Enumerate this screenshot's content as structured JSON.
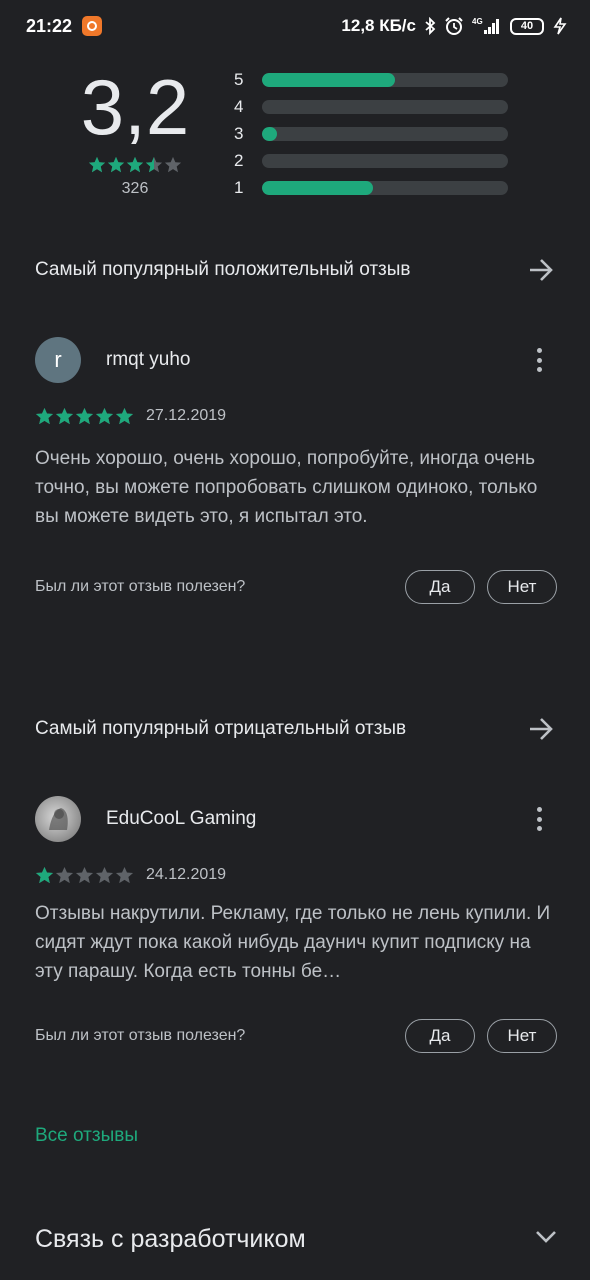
{
  "status_bar": {
    "time": "21:22",
    "net_speed": "12,8 КБ/с",
    "network": "4G",
    "battery": "40",
    "icons": [
      "app-notification-icon",
      "bluetooth-icon",
      "alarm-icon",
      "signal-icon",
      "battery-icon",
      "charging-icon"
    ]
  },
  "rating": {
    "score": "3,2",
    "stars_value": 3.5,
    "total": "326",
    "histogram": [
      {
        "label": "5",
        "fraction": 0.54
      },
      {
        "label": "4",
        "fraction": 0.0
      },
      {
        "label": "3",
        "fraction": 0.06
      },
      {
        "label": "2",
        "fraction": 0.0
      },
      {
        "label": "1",
        "fraction": 0.45
      }
    ]
  },
  "positive": {
    "section_title": "Самый популярный положительный отзыв",
    "avatar_letter": "r",
    "name": "rmqt yuho",
    "stars": 5,
    "date": "27.12.2019",
    "text": "Очень хорошо, очень хорошо, попробуйте, иногда очень точно, вы можете попробовать слишком одиноко, только вы можете видеть это, я испытал это.",
    "helpful_question": "Был ли этот отзыв полезен?",
    "yes": "Да",
    "no": "Нет"
  },
  "negative": {
    "section_title": "Самый популярный отрицательный отзыв",
    "name": "EduCooL Gaming",
    "stars": 1,
    "date": "24.12.2019",
    "text": "Отзывы накрутили. Рекламу, где только не лень купили. И сидят ждут пока какой нибудь даунич купит подписку на эту парашу. Когда есть тонны бе…",
    "helpful_question": "Был ли этот отзыв полезен?",
    "yes": "Да",
    "no": "Нет"
  },
  "all_reviews": "Все отзывы",
  "contact": "Связь с разработчиком",
  "colors": {
    "background": "#202124",
    "accent": "#1ea97c",
    "track": "#3c4043",
    "star_empty": "#5f6368"
  }
}
